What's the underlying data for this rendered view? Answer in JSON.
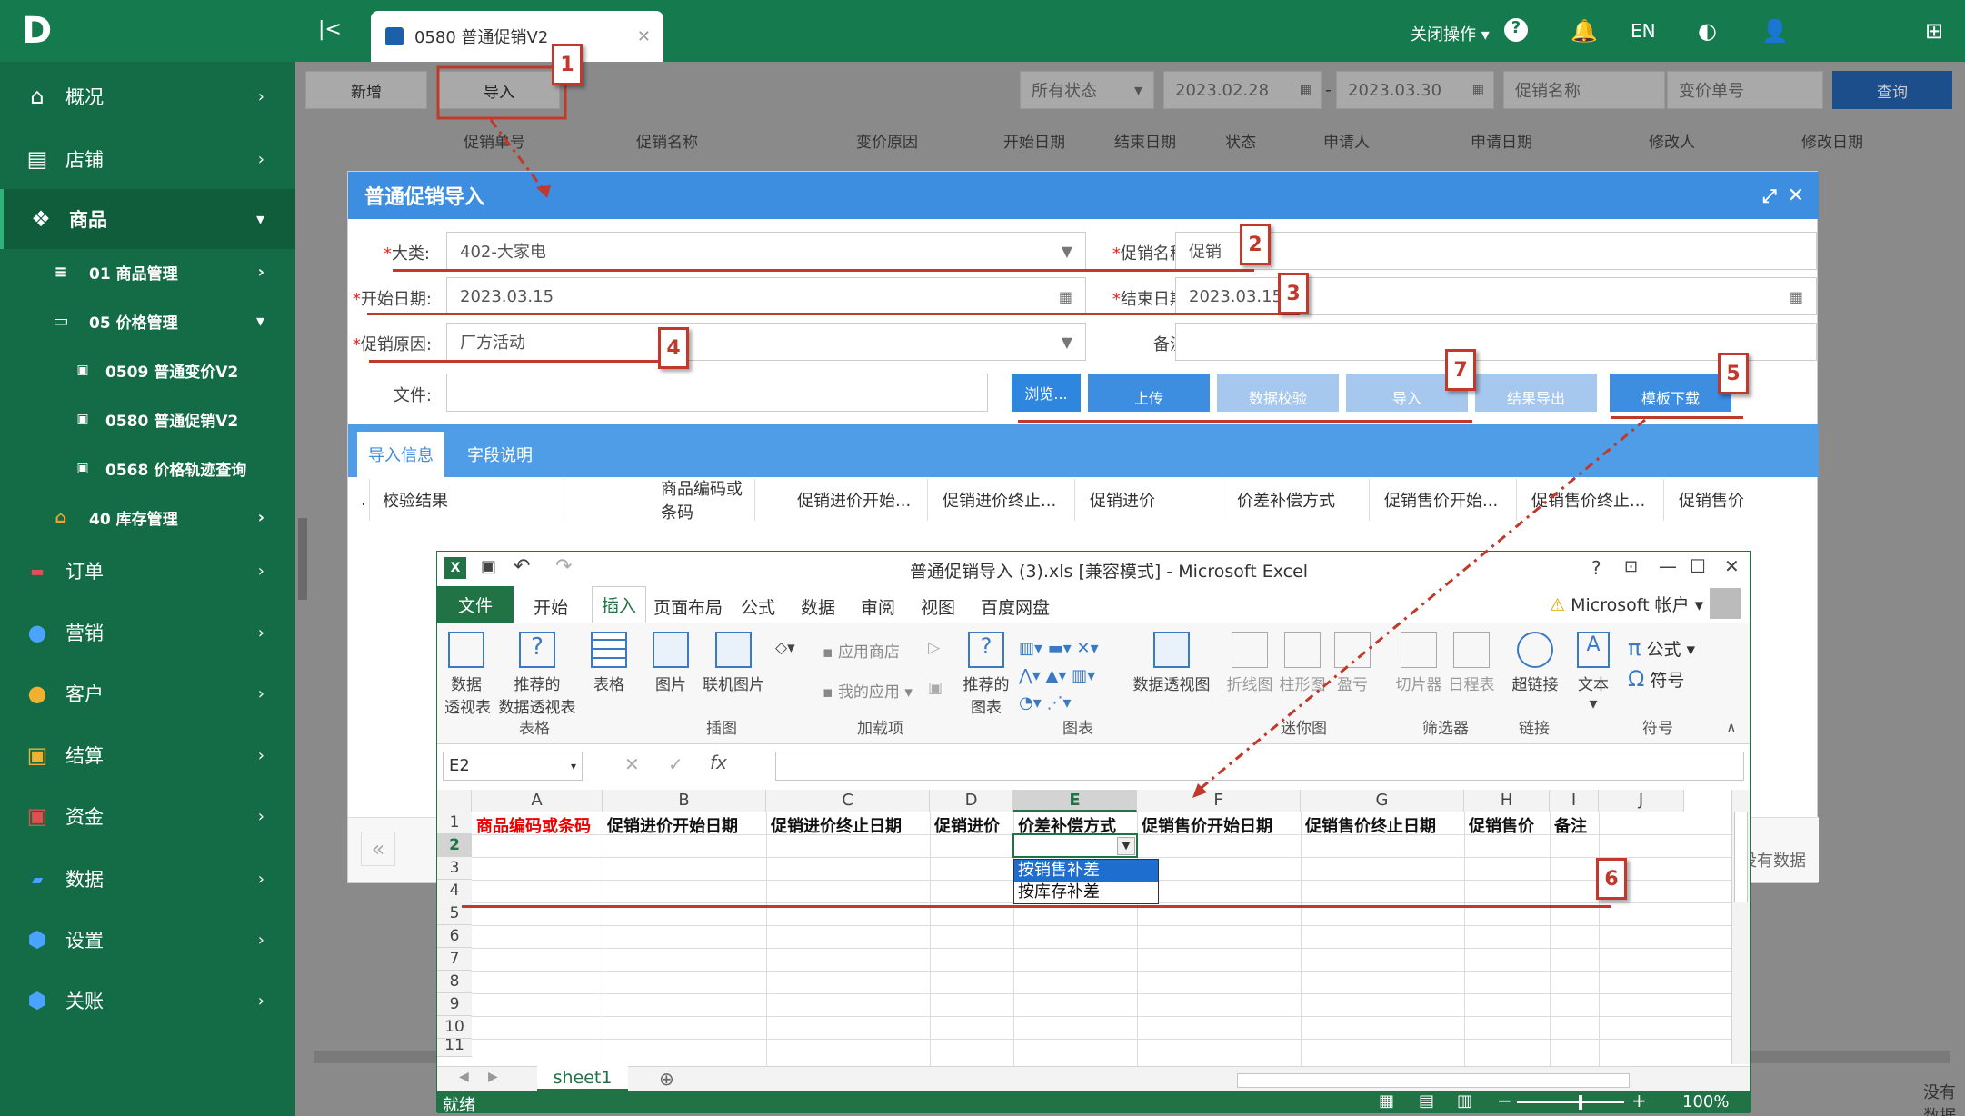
{
  "app": {
    "logo": "D"
  },
  "topbar": {
    "tab_label": "0580 普通促销V2",
    "close_ops": "关闭操作",
    "lang": "EN"
  },
  "sidebar": {
    "items": [
      {
        "label": "概况"
      },
      {
        "label": "店铺"
      },
      {
        "label": "商品"
      },
      {
        "label": "01 商品管理"
      },
      {
        "label": "05 价格管理"
      },
      {
        "label": "0509 普通变价V2"
      },
      {
        "label": "0580 普通促销V2"
      },
      {
        "label": "0568 价格轨迹查询"
      },
      {
        "label": "40 库存管理"
      },
      {
        "label": "订单"
      },
      {
        "label": "营销"
      },
      {
        "label": "客户"
      },
      {
        "label": "结算"
      },
      {
        "label": "资金"
      },
      {
        "label": "数据"
      },
      {
        "label": "设置"
      },
      {
        "label": "关账"
      }
    ]
  },
  "toolbar": {
    "add": "新增",
    "import": "导入",
    "status": "所有状态",
    "date_from": "2023.02.28",
    "date_to": "2023.03.30",
    "name_ph": "促销名称",
    "no_ph": "变价单号",
    "query": "查询"
  },
  "columns": [
    "促销单号",
    "促销名称",
    "变价原因",
    "开始日期",
    "结束日期",
    "状态",
    "申请人",
    "申请日期",
    "修改人",
    "修改日期"
  ],
  "dialog": {
    "title": "普通促销导入",
    "category_label": "大类:",
    "category_value": "402-大家电",
    "promo_name_label": "促销名称:",
    "promo_name_value": "促销",
    "start_label": "开始日期:",
    "start_value": "2023.03.15",
    "end_label": "结束日期:",
    "end_value": "2023.03.15",
    "reason_label": "促销原因:",
    "reason_value": "厂方活动",
    "remark_label": "备注:",
    "file_label": "文件:",
    "browse": "浏览...",
    "upload": "上传",
    "validate": "数据校验",
    "import": "导入",
    "export": "结果导出",
    "template": "模板下载",
    "tab_info": "导入信息",
    "tab_fields": "字段说明",
    "grid_cols": [
      "校验结果",
      "商品编码或条码",
      "促销进价开始...",
      "促销进价终止...",
      "促销进价",
      "价差补偿方式",
      "促销售价开始...",
      "促销售价终止...",
      "促销售价"
    ]
  },
  "under": {
    "no_data": "没有数据",
    "no_data2": "没有数据",
    "pager_prev": "«"
  },
  "badges": [
    "1",
    "2",
    "3",
    "4",
    "5",
    "6",
    "7"
  ],
  "excel": {
    "title": "普通促销导入 (3).xls  [兼容模式] - Microsoft Excel",
    "help": "?",
    "account": "Microsoft 帐户",
    "tabs": [
      "文件",
      "开始",
      "插入",
      "页面布局",
      "公式",
      "数据",
      "审阅",
      "视图",
      "百度网盘"
    ],
    "groups": [
      {
        "t": "数据\n透视表"
      },
      {
        "t": "推荐的\n数据透视表"
      },
      {
        "t": "表格"
      },
      {
        "t": "图片"
      },
      {
        "t": "联机图片"
      },
      {
        "t": "应用商店"
      },
      {
        "t": "我的应用"
      },
      {
        "t": "推荐的\n图表"
      },
      {
        "t": "数据透视图"
      },
      {
        "t": "折线图"
      },
      {
        "t": "柱形图"
      },
      {
        "t": "盈亏"
      },
      {
        "t": "切片器"
      },
      {
        "t": "日程表"
      },
      {
        "t": "超链接"
      },
      {
        "t": "文本"
      },
      {
        "t": "公式"
      },
      {
        "t": "符号"
      }
    ],
    "group_labels": [
      "表格",
      "插图",
      "加载项",
      "图表",
      "迷你图",
      "筛选器",
      "链接",
      "符号"
    ],
    "namebox": "E2",
    "fx": "fx",
    "cols": [
      "A",
      "B",
      "C",
      "D",
      "E",
      "F",
      "G",
      "H",
      "I",
      "J"
    ],
    "headers": [
      "商品编码或条码",
      "促销进价开始日期",
      "促销进价终止日期",
      "促销进价",
      "价差补偿方式",
      "促销售价开始日期",
      "促销售价终止日期",
      "促销售价",
      "备注"
    ],
    "rows": [
      "1",
      "2",
      "3",
      "4",
      "5",
      "6",
      "7",
      "8",
      "9",
      "10",
      "11"
    ],
    "dropdown": [
      "按销售补差",
      "按库存补差"
    ],
    "sheet": "sheet1",
    "status": "就绪",
    "zoom": "100%"
  }
}
